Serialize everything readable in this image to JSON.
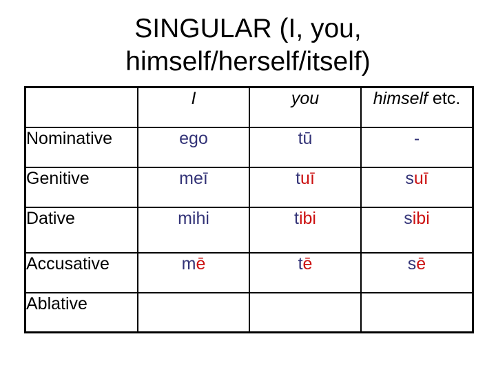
{
  "title": {
    "line1": "SINGULAR (I, you,",
    "line2": "himself/herself/itself)"
  },
  "colors": {
    "stem": "#333377",
    "ending": "#cc1111"
  },
  "table": {
    "headers": {
      "col1": "I",
      "col2": "you",
      "col3_italic": "himself",
      "col3_rest": " etc."
    },
    "rows": [
      {
        "case": "Nominative",
        "I": {
          "stem": "ego",
          "ending": ""
        },
        "you": {
          "stem": "tū",
          "ending": ""
        },
        "self": {
          "stem": "-",
          "ending": ""
        }
      },
      {
        "case": "Genitive",
        "I": {
          "stem": "meī",
          "ending": ""
        },
        "you": {
          "stem": "t",
          "ending": "uī"
        },
        "self": {
          "stem": "s",
          "ending": "uī"
        }
      },
      {
        "case": "Dative",
        "I": {
          "stem": "mihi",
          "ending": ""
        },
        "you": {
          "stem": "t",
          "ending": "ibi"
        },
        "self": {
          "stem": "s",
          "ending": "ibi"
        }
      },
      {
        "case": "Accusative",
        "I": {
          "stem": "m",
          "ending": "ē"
        },
        "you": {
          "stem": "t",
          "ending": "ē"
        },
        "self": {
          "stem": "s",
          "ending": "ē"
        }
      },
      {
        "case": "Ablative",
        "I": {
          "stem": "",
          "ending": ""
        },
        "you": {
          "stem": "",
          "ending": ""
        },
        "self": {
          "stem": "",
          "ending": ""
        }
      }
    ]
  }
}
